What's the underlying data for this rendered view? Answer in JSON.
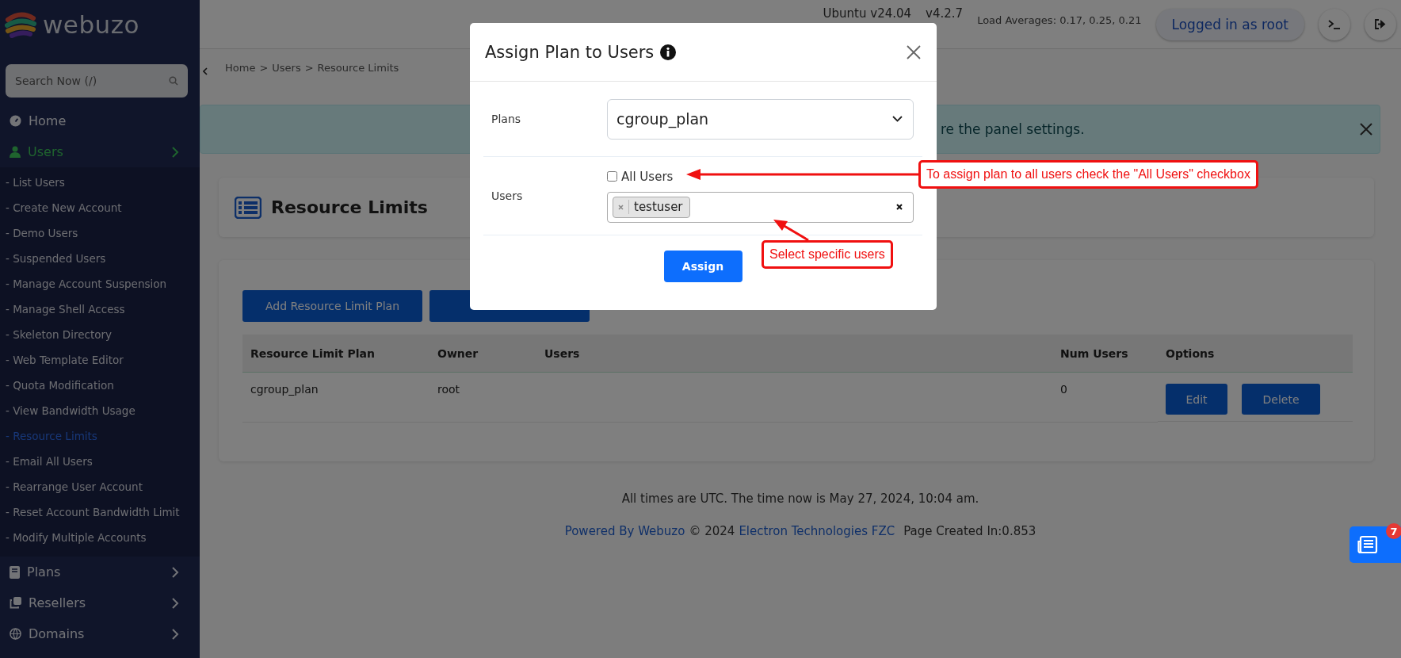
{
  "sidebar": {
    "logo": "webuzo",
    "search": {
      "placeholder": "Search Now (/)"
    },
    "items": [
      {
        "kind": "link",
        "label": "Home",
        "selected": false
      },
      {
        "kind": "group",
        "label": "Users",
        "selected": true,
        "children": [
          {
            "label": "- List Users",
            "selected": false
          },
          {
            "label": "- Create New Account",
            "selected": false
          },
          {
            "label": "- Demo Users",
            "selected": false
          },
          {
            "label": "- Suspended Users",
            "selected": false
          },
          {
            "label": "- Manage Account Suspension",
            "selected": false
          },
          {
            "label": "- Manage Shell Access",
            "selected": false
          },
          {
            "label": "- Skeleton Directory",
            "selected": false
          },
          {
            "label": "- Web Template Editor",
            "selected": false
          },
          {
            "label": "- Quota Modification",
            "selected": false
          },
          {
            "label": "- View Bandwidth Usage",
            "selected": false
          },
          {
            "label": "- Resource Limits",
            "selected": true
          },
          {
            "label": "- Email All Users",
            "selected": false
          },
          {
            "label": "- Rearrange User Account",
            "selected": false
          },
          {
            "label": "- Reset Account Bandwidth Limit",
            "selected": false
          },
          {
            "label": "- Modify Multiple Accounts",
            "selected": false
          }
        ]
      },
      {
        "kind": "group",
        "label": "Plans",
        "selected": false
      },
      {
        "kind": "group",
        "label": "Resellers",
        "selected": false
      },
      {
        "kind": "group",
        "label": "Domains",
        "selected": false
      }
    ]
  },
  "topbar": {
    "os": "Ubuntu v24.04",
    "version": "v4.2.7",
    "load": "Load Averages: 0.17, 0.25, 0.21",
    "user_button": "Logged in as root"
  },
  "breadcrumb": {
    "separator": ">",
    "items": [
      "Home",
      "Users",
      "Resource Limits"
    ]
  },
  "alert": {
    "text": "re the panel settings."
  },
  "page_title": "Resource Limits",
  "toolbar": [
    {
      "kind": "labeled",
      "label": "Add Resource Limit Plan"
    },
    {
      "kind": "covered"
    }
  ],
  "table": {
    "columns": [
      "Resource Limit Plan",
      "Owner",
      "Users",
      "Num Users",
      "Options"
    ],
    "rows": [
      {
        "plan": "cgroup_plan",
        "owner": "root",
        "num_users": "0",
        "actions": [
          "Edit",
          "Delete"
        ]
      }
    ]
  },
  "footer": {
    "time_note": "All times are UTC. The time now is May 27, 2024, 10:04 am.",
    "powered_link": "Powered By Webuzo",
    "copyright": "© 2024",
    "company_link": "Electron Technologies FZC",
    "page_created": "Page Created In:0.853"
  },
  "float_button": {
    "badge": "7"
  },
  "modal": {
    "title": "Assign Plan to Users",
    "fields": [
      {
        "kind": "select",
        "label": "Plans",
        "value": "cgroup_plan"
      },
      {
        "kind": "users",
        "label": "Users",
        "checkbox": {
          "label": "All Users",
          "checked": false
        },
        "tags": [
          "testuser"
        ]
      }
    ],
    "submit": "Assign"
  },
  "annotations": [
    {
      "text": "To assign plan to all users check the \"All Users\" checkbox"
    },
    {
      "text": "Select specific users"
    }
  ]
}
